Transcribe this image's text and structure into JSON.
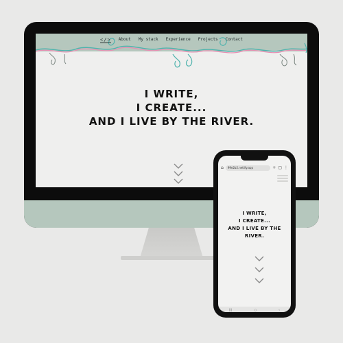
{
  "colors": {
    "page_background": "#e9e9e8",
    "device_frame": "#0c0c0c",
    "accent_sage": "#b5c7bd",
    "squiggle_teal": "#4fb3ad",
    "squiggle_pink": "#e88fb3",
    "hero_text": "#111111"
  },
  "desktop": {
    "nav": {
      "logo": "</>",
      "items": [
        "About",
        "My stack",
        "Experience",
        "Projects",
        "Contact"
      ]
    },
    "hero": {
      "line1": "I WRITE,",
      "line2": "I CREATE...",
      "line3": "AND I LIVE BY THE RIVER."
    },
    "scroll_icon": "triple-chevron-down"
  },
  "mobile": {
    "url": "99e2b2.netlify.app",
    "hero": {
      "line1": "I WRITE,",
      "line2": "I CREATE...",
      "line3": "AND I LIVE BY THE RIVER."
    },
    "scroll_icon": "triple-chevron-down"
  }
}
